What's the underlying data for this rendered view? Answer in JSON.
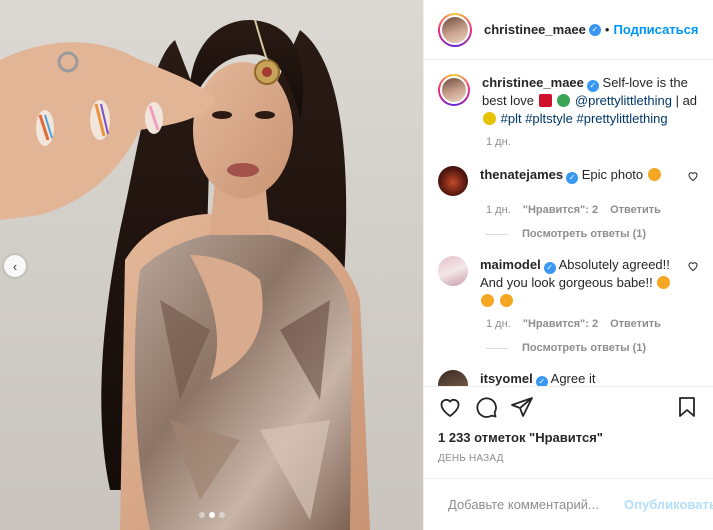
{
  "post": {
    "author": "christinee_maee",
    "follow_label": "Подписаться",
    "dot": "•",
    "caption_text": "Self-love is the best love",
    "caption_mention": "@prettylittlething",
    "caption_suffix": "| ad",
    "caption_tags": "#plt #pltstyle #prettylittlething",
    "caption_time": "1 дн.",
    "likes": "1 233 отметок \"Нравится\"",
    "posted": "ДЕНЬ НАЗАД",
    "carousel": {
      "total": 3,
      "current": 2
    }
  },
  "comments": [
    {
      "user": "thenatejames",
      "text": "Epic photo",
      "time": "1 дн.",
      "likes": "\"Нравится\": 2",
      "reply": "Ответить",
      "view_replies": "Посмотреть ответы (1)"
    },
    {
      "user": "maimodel",
      "text": "Absolutely agreed!! And you look gorgeous babe!!",
      "time": "1 дн.",
      "likes": "\"Нравится\": 2",
      "reply": "Ответить",
      "view_replies": "Посмотреть ответы (1)"
    },
    {
      "user": "itsyomel",
      "text": "Agree it"
    }
  ],
  "add_comment": {
    "placeholder": "Добавьте комментарий...",
    "publish_label": "Опубликовать"
  },
  "icons": {
    "like": "heart-icon",
    "comment": "speech-bubble-icon",
    "share": "paper-plane-icon",
    "save": "bookmark-icon",
    "emoji": "smiley-icon",
    "prev": "chevron-left-icon"
  },
  "colors": {
    "accent": "#0095f6",
    "link": "#00376b",
    "muted": "#8e8e8e",
    "verified": "#3897f0",
    "publish_disabled": "#b2dffc"
  }
}
